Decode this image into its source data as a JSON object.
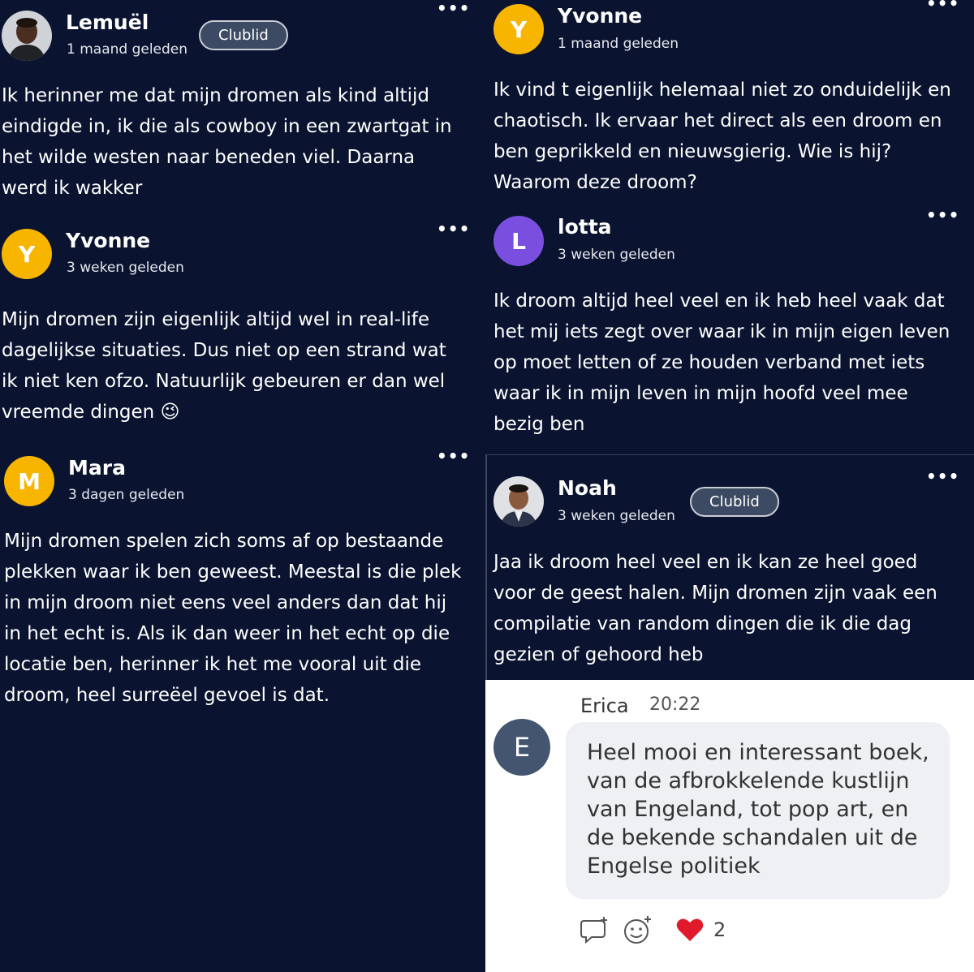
{
  "posts_left": [
    {
      "name": "Lemuël",
      "time": "1 maand geleden",
      "badge": "Clublid",
      "avatar_initial": "",
      "body": [
        "Ik herinner me dat mijn dromen als kind altijd",
        "eindigde in, ik die als cowboy in een zwartgat in",
        "het wilde westen naar beneden viel. Daarna",
        "werd ik wakker"
      ]
    },
    {
      "name": "Yvonne",
      "time": "3 weken geleden",
      "avatar_initial": "Y",
      "body": [
        "Mijn dromen zijn eigenlijk altijd wel in real-life",
        "dagelijkse situaties. Dus niet op een strand wat",
        "ik niet ken ofzo. Natuurlijk gebeuren er dan wel",
        "vreemde dingen 😉"
      ]
    },
    {
      "name": "Mara",
      "time": "3 dagen geleden",
      "avatar_initial": "M",
      "body": [
        "Mijn dromen spelen zich soms af op bestaande",
        "plekken waar ik ben geweest. Meestal is die plek",
        "in mijn droom niet eens veel anders dan dat hij",
        "in het echt is. Als ik dan weer in het echt op die",
        "locatie ben, herinner ik het me vooral uit die",
        "droom, heel surreëel gevoel is dat."
      ]
    }
  ],
  "posts_right": [
    {
      "name": "Yvonne",
      "time": "1 maand geleden",
      "avatar_initial": "Y",
      "body": [
        "Ik vind t eigenlijk helemaal niet zo onduidelijk en",
        "chaotisch. Ik ervaar het direct als een droom en",
        "ben geprikkeld en nieuwsgierig. Wie is hij?",
        "Waarom deze droom?"
      ]
    },
    {
      "name": "lotta",
      "time": "3 weken geleden",
      "avatar_initial": "L",
      "body": [
        "Ik droom altijd heel veel en ik heb heel vaak dat",
        "het mij iets zegt over waar ik in mijn eigen leven",
        "op moet letten of ze houden verband met iets",
        "waar ik in mijn leven in mijn hoofd veel mee",
        "bezig ben"
      ]
    },
    {
      "name": "Noah",
      "time": "3 weken geleden",
      "badge": "Clublid",
      "avatar_initial": "",
      "body": [
        "Jaa ik droom heel veel en ik kan ze heel goed",
        "voor de geest halen. Mijn dromen zijn vaak een",
        "compilatie van random dingen die ik die dag",
        "gezien of gehoord heb"
      ]
    }
  ],
  "more_icon": "ellipsis-icon",
  "chat": {
    "avatar_initial": "E",
    "name": "Erica",
    "time": "20:22",
    "message": [
      "Heel mooi en interessant boek,",
      "van de afbrokkelende kustlijn",
      "van Engeland, tot pop art, en",
      "de bekende schandalen uit de",
      "Engelse politiek"
    ],
    "reaction_count": "2",
    "icons": [
      "reply-icon",
      "add-reaction-icon",
      "heart-icon"
    ]
  },
  "colors": {
    "background": "#0a1430",
    "avatar_yellow": "#f7b500",
    "avatar_purple": "#7a4fe0",
    "heart": "#e0192b"
  }
}
